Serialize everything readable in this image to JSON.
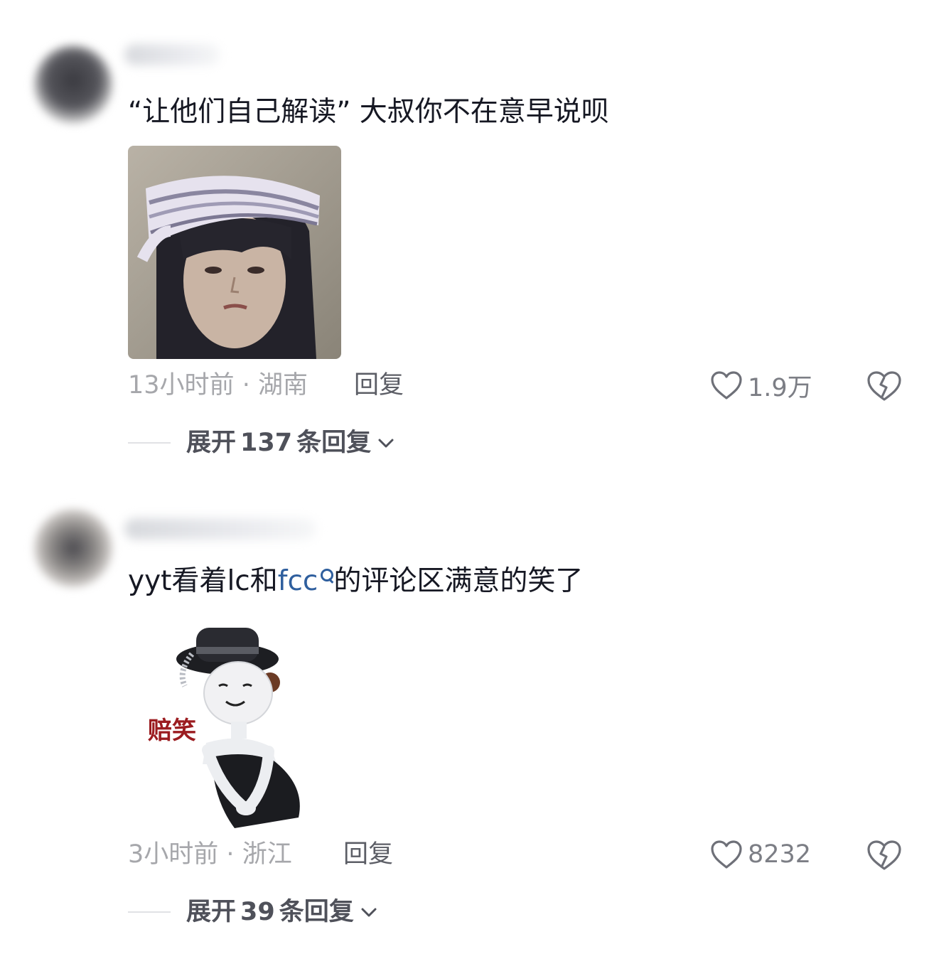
{
  "comments": [
    {
      "text": "“让他们自己解读” 大叔你不在意早说呗",
      "image_desc": "woman-with-headband-sticker",
      "time": "13小时前",
      "separator": "·",
      "location": "湖南",
      "reply_label": "回复",
      "likes": "1.9万",
      "expand_prefix": "展开 ",
      "expand_count": "137",
      "expand_suffix": " 条回复"
    },
    {
      "text_before": "yyt看着lc和",
      "text_link": "fcc",
      "text_after": "的评论区满意的笑了",
      "image_caption": "赔笑",
      "time": "3小时前",
      "separator": "·",
      "location": "浙江",
      "reply_label": "回复",
      "likes": "8232",
      "expand_prefix": "展开 ",
      "expand_count": "39",
      "expand_suffix": " 条回复"
    }
  ],
  "icons": {
    "like": "heart-outline-icon",
    "dislike": "broken-heart-icon",
    "expand": "chevron-down-icon",
    "search": "search-icon"
  },
  "colors": {
    "link": "#2f5f9e",
    "meta_gray": "#a6a7ab",
    "caption_red": "#9b1c20"
  }
}
